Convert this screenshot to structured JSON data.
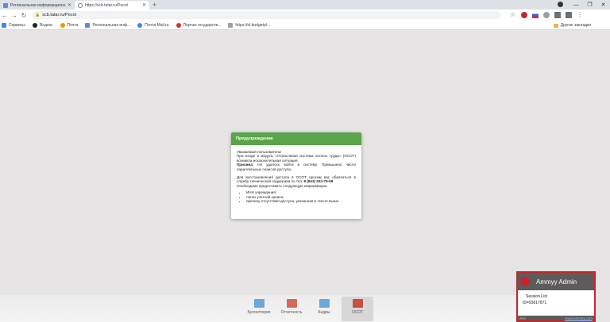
{
  "browser": {
    "tabs": [
      {
        "title": "Региональная информационн...",
        "active": false
      },
      {
        "title": "https://scb.tatar.ru/Pocot",
        "active": true
      }
    ],
    "new_tab": "+",
    "url": "scb.tatar.ru/Pocot"
  },
  "bookmarks": [
    {
      "label": "Сервисы",
      "color": "#4285f4"
    },
    {
      "label": "Яндекс",
      "color": "#222222"
    },
    {
      "label": "Почта",
      "color": "#f29900"
    },
    {
      "label": "Региональная инф...",
      "color": "#5f8dd3"
    },
    {
      "label": "Почта Mail.ru",
      "color": "#4285f4"
    },
    {
      "label": "Портал государств...",
      "color": "#d93025"
    },
    {
      "label": "https://ol.budgetpl...",
      "color": "#9aa0a6"
    }
  ],
  "other_bookmarks": "Другие закладки",
  "dialog": {
    "title": "Предупреждение",
    "greeting": "Уважаемый пользователь!",
    "line1": "При входе в модуль «Отраслевая система оплаты труда» (ОСОТ) возникла исключительная ситуация.",
    "reason_label": "Причина:",
    "reason_text": "Не удалось войти в систему. Превышено число параллельных сеансов доступа.",
    "restore_text": "Для восстановления доступа в ОСОТ просим вас обратиться в службу технической поддержки по тел.",
    "phone": "8 (843) 524-75-99",
    "need_text": "Необходимо предоставить следующую информацию:",
    "items": [
      "ИНН учреждения;",
      "логин учетной записи;",
      "причину отсутствия доступа, указанная в тексте выше."
    ]
  },
  "dock": [
    {
      "label": "Бухгалтерия",
      "color": "#6aa9d8",
      "active": false
    },
    {
      "label": "Отчетность",
      "color": "#d9685a",
      "active": false
    },
    {
      "label": "Кадры",
      "color": "#6aa9d8",
      "active": false
    },
    {
      "label": "ОСОТ",
      "color": "#c8503f",
      "active": true
    }
  ],
  "ammyy": {
    "title": "Ammyy Admin",
    "session_list": "Session List",
    "id": "ID=93617871",
    "footer_left": ">>>",
    "footer_link": "www.ammyy.com"
  }
}
